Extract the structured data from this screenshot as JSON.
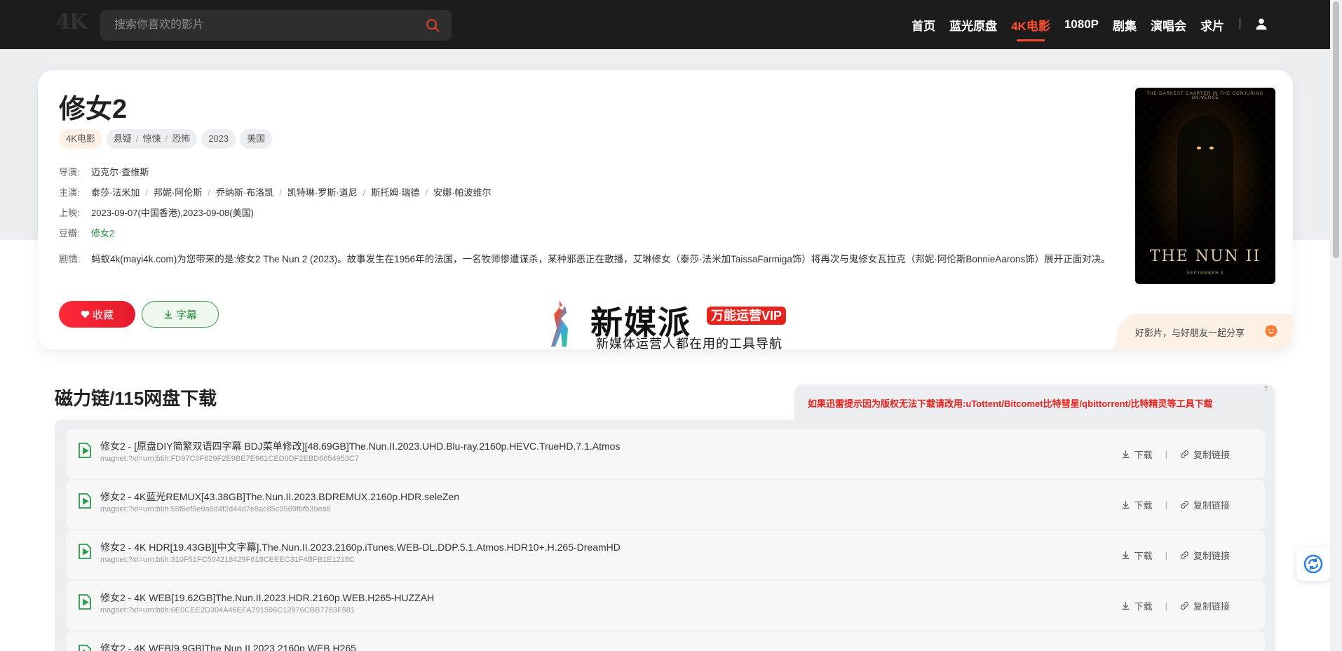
{
  "header": {
    "logo_text": "4K",
    "search_placeholder": "搜索你喜欢的影片",
    "nav": [
      "首页",
      "蓝光原盘",
      "4K电影",
      "1080P",
      "剧集",
      "演唱会",
      "求片"
    ],
    "active_nav": "4K电影"
  },
  "movie": {
    "title": "修女2",
    "category_tag": "4K电影",
    "genres": [
      "悬疑",
      "惊悚",
      "恐怖"
    ],
    "year": "2023",
    "region": "美国",
    "director_label": "导演:",
    "director": "迈克尔·查维斯",
    "cast_label": "主演:",
    "cast": [
      "泰莎·法米加",
      "邦妮·阿伦斯",
      "乔纳斯·布洛凯",
      "凯特琳·罗斯·道尼",
      "斯托姆·瑞德",
      "安娜·帕波维尔"
    ],
    "release_label": "上映:",
    "release": "2023-09-07(中国香港),2023-09-08(美国)",
    "douban_label": "豆瓣:",
    "douban": "修女2",
    "plot_label": "剧情:",
    "plot": "蚂蚁4k(mayi4k.com)为您带来的是:修女2 The Nun 2 (2023)。故事发生在1956年的法国，一名牧师惨遭谋杀，某种邪恶正在散播，艾琳修女（泰莎·法米加TaissaFarmiga饰）将再次与鬼修女瓦拉克（邦妮·阿伦斯BonnieAarons饰）展开正面对决。",
    "fav_button": "收藏",
    "subtitle_button": "字幕",
    "share_text": "好影片，与好朋友一起分享",
    "poster": {
      "title": "THE NUN II",
      "tagline": "THE DARKEST CHAPTER IN THE CONJURING UNIVERSE",
      "date": "SEPTEMBER 8"
    }
  },
  "watermark": {
    "title": "新媒派",
    "badge": "万能运营VIP",
    "subtitle": "新媒体运营人都在用的工具导航"
  },
  "downloads": {
    "heading": "磁力链/115网盘下载",
    "notice": "如果迅雷提示因为版权无法下载请改用:uTottent/Bitcomet比特彗星/qbittorrent/比特精灵等工具下载",
    "notice_mark": "?",
    "download_label": "下载",
    "copy_label": "复制链接",
    "items": [
      {
        "name": "修女2 - [原盘DIY简繁双语四字幕 BDJ菜单修改][48.69GB]The.Nun.II.2023.UHD.Blu-ray.2160p.HEVC.TrueHD.7.1.Atmos",
        "magnet": "magnet:?xt=urn:btih:FD97C0F629F2E9BE7E961CED0DF2EBD6654953C7"
      },
      {
        "name": "修女2 - 4K蓝光REMUX[43.38GB]The.Nun.II.2023.BDREMUX.2160p.HDR.seleZen",
        "magnet": "magnet:?xt=urn:btih:55f6ef5e9a6d4f2d44d7e8ac85c0569fbfb39ea6"
      },
      {
        "name": "修女2 - 4K HDR[19.43GB][中文字幕].The.Nun.II.2023.2160p.iTunes.WEB-DL.DDP.5.1.Atmos.HDR10+.H.265-DreamHD",
        "magnet": "magnet:?xt=urn:btih:310F51FC504218429F618CEEEC31F4BFB1E1218C"
      },
      {
        "name": "修女2 - 4K WEB[19.62GB]The.Nun.II.2023.HDR.2160p.WEB.H265-HUZZAH",
        "magnet": "magnet:?xt=urn:btih:6E0CEE2D304A46EFA791596C12976CBB7783F581"
      },
      {
        "name": "修女2 - 4K WEB[9.9GB]The Nun II 2023 2160p WEB H265",
        "magnet": ""
      }
    ]
  },
  "colors": {
    "header_bg": "#1c1c1c",
    "accent": "#ff4d2d",
    "fav_red": "#e31a2a",
    "subtitle_green": "#2b8a3a",
    "notice_red": "#e8231e"
  }
}
